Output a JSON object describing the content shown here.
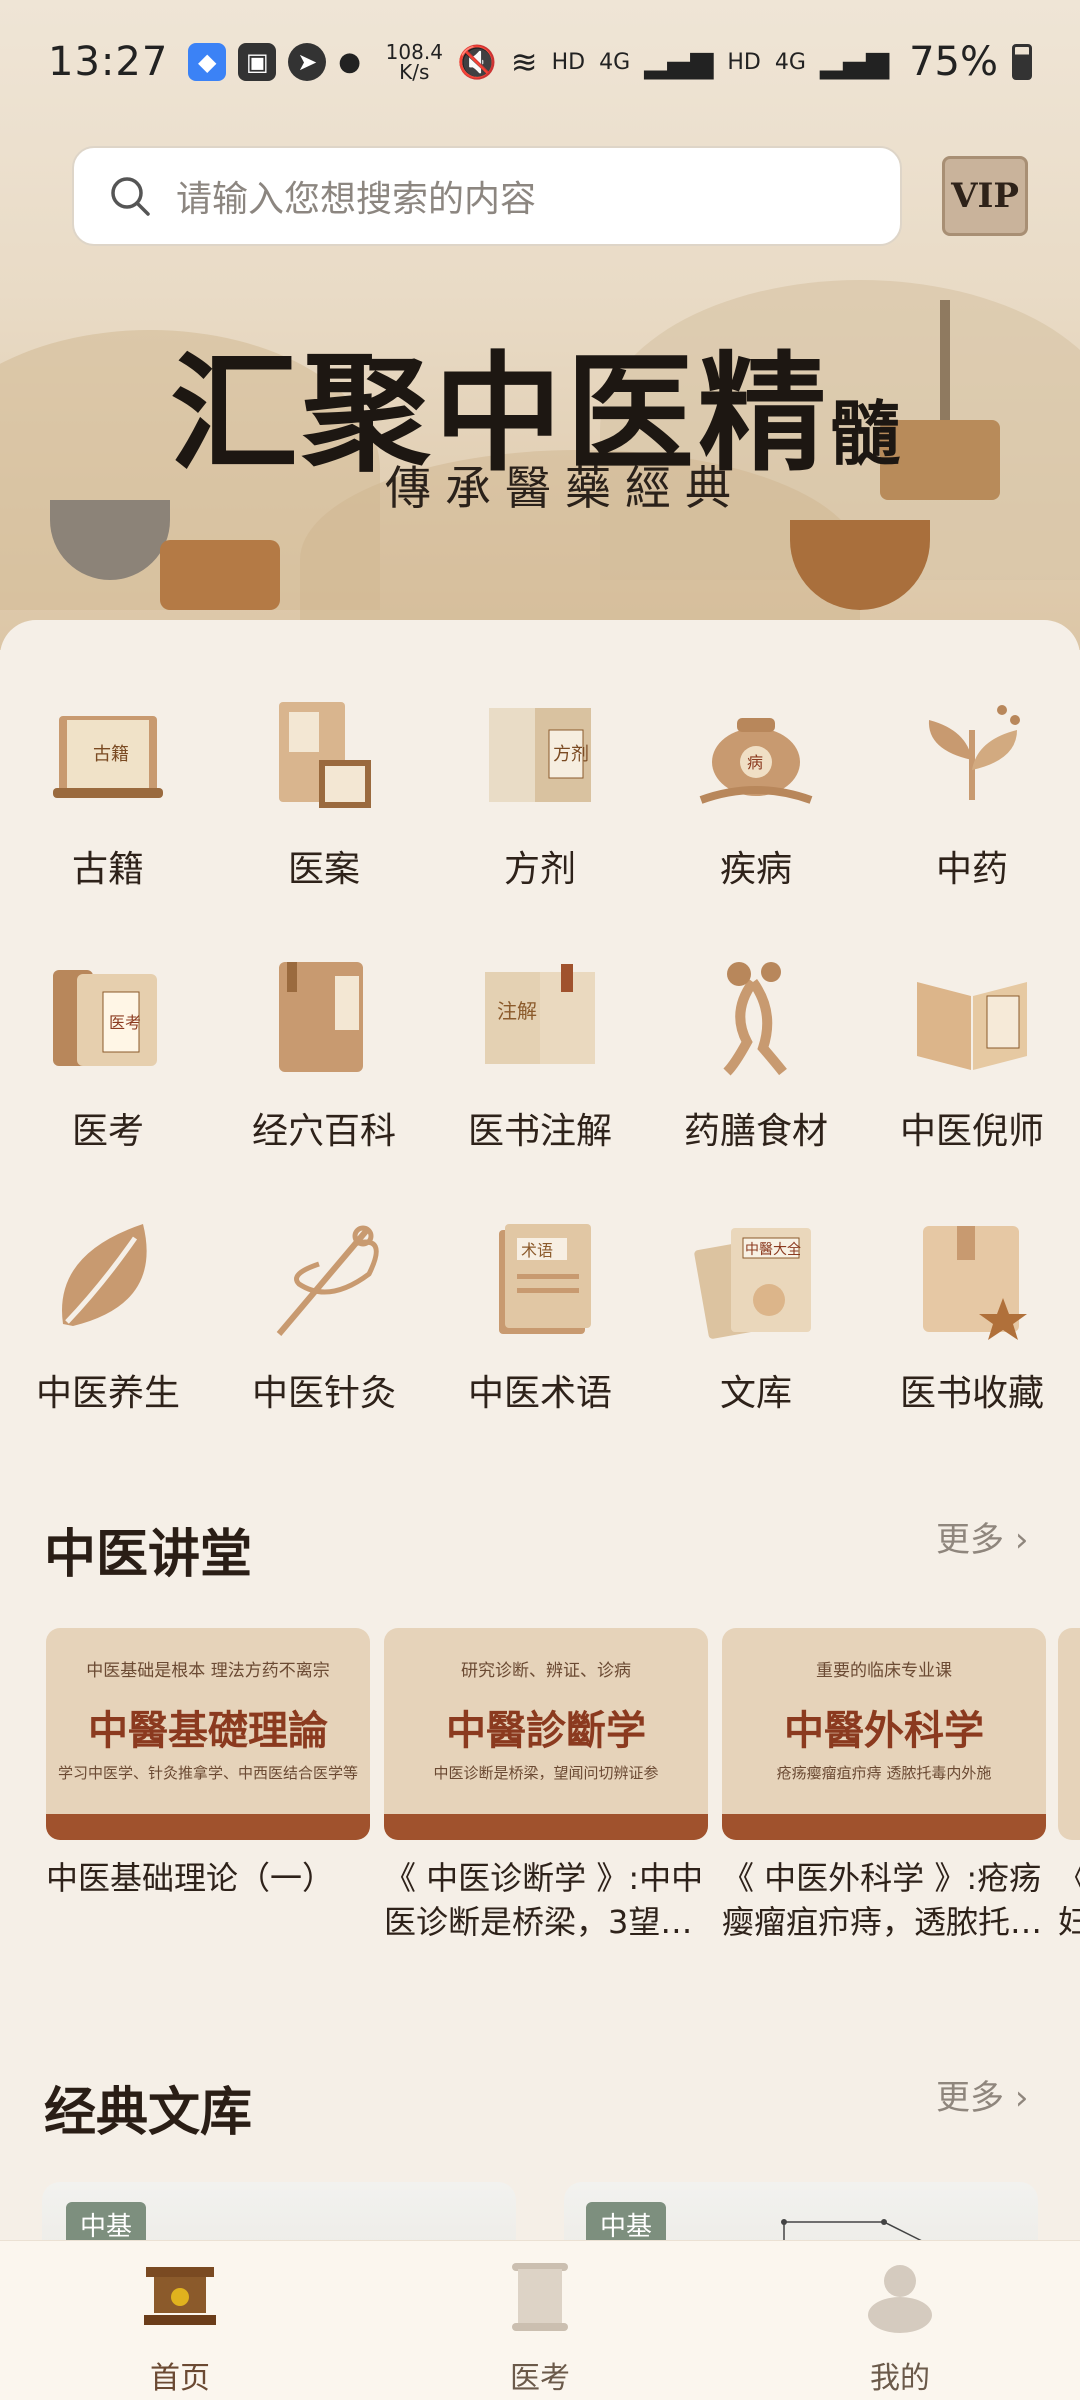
{
  "status_bar": {
    "time": "13:27",
    "net_speed": "108.4\nK/s",
    "net_speed_value": "108.4",
    "net_speed_unit": "K/s",
    "hd1": "HD",
    "sig1": "4G",
    "hd2": "HD",
    "sig2": "4G",
    "battery": "75%"
  },
  "search": {
    "placeholder": "请输入您想搜索的内容"
  },
  "vip_label": "VIP",
  "banner": {
    "title_main": "汇聚中医精",
    "title_tail": "髓",
    "subtitle": "傳承醫藥經典"
  },
  "categories": [
    {
      "label": "古籍",
      "icon": "ancient-book-icon"
    },
    {
      "label": "医案",
      "icon": "medical-case-icon"
    },
    {
      "label": "方剂",
      "icon": "prescription-icon"
    },
    {
      "label": "疾病",
      "icon": "disease-pot-icon"
    },
    {
      "label": "中药",
      "icon": "herb-icon"
    },
    {
      "label": "医考",
      "icon": "exam-icon"
    },
    {
      "label": "经穴百科",
      "icon": "acupoint-book-icon"
    },
    {
      "label": "医书注解",
      "icon": "annotation-book-icon"
    },
    {
      "label": "药膳食材",
      "icon": "ginseng-icon"
    },
    {
      "label": "中医倪师",
      "icon": "ni-teacher-book-icon"
    },
    {
      "label": "中医养生",
      "icon": "leaf-icon"
    },
    {
      "label": "中医针灸",
      "icon": "acupuncture-needle-icon"
    },
    {
      "label": "中医术语",
      "icon": "terminology-icon"
    },
    {
      "label": "文库",
      "icon": "library-icon"
    },
    {
      "label": "医书收藏",
      "icon": "bookmark-star-icon"
    }
  ],
  "lecture": {
    "title": "中医讲堂",
    "more": "更多",
    "courses": [
      {
        "top": "中医基础是根本  理法方药不离宗",
        "big": "中醫基礎理論",
        "bottom": "学习中医学、针灸推拿学、中西医结合医学等",
        "text": "中医基础理论（一）"
      },
      {
        "top": "研究诊断、辨证、诊病",
        "big": "中醫診斷学",
        "bottom": "中医诊断是桥梁，望闻问切辨证参",
        "text": "《 中医诊断学 》:中中医诊断是桥梁，3望…"
      },
      {
        "top": "重要的临床专业课",
        "big": "中醫外科学",
        "bottom": "疮疡瘿瘤疽疖痔  透脓托毒内外施",
        "text": "《 中医外科学 》:疮疡瘿瘤疽疖痔，透脓托…"
      }
    ],
    "partial_text": "《\n妇"
  },
  "library": {
    "title": "经典文库",
    "more": "更多",
    "cards": [
      {
        "tag": "中基"
      },
      {
        "tag": "中基"
      }
    ]
  },
  "tabs": [
    {
      "label": "首页",
      "icon": "home-pavilion-icon",
      "active": true
    },
    {
      "label": "医考",
      "icon": "scroll-icon",
      "active": false
    },
    {
      "label": "我的",
      "icon": "buddha-icon",
      "active": false
    }
  ],
  "colors": {
    "accent": "#a0522d",
    "background": "#f5efe7",
    "icon_tan": "#c89a70"
  }
}
